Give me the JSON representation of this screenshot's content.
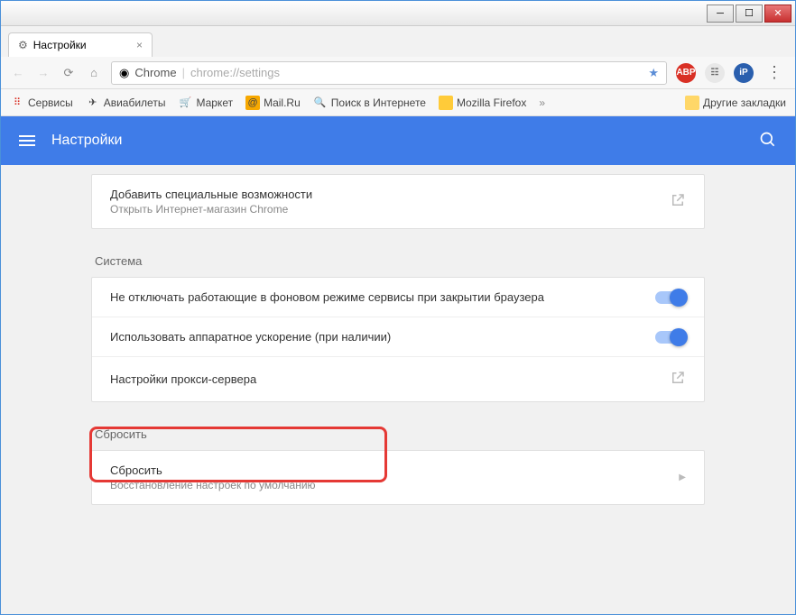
{
  "tab": {
    "title": "Настройки"
  },
  "omnibox": {
    "label": "Chrome",
    "url": "chrome://settings"
  },
  "bookmarks": {
    "items": [
      {
        "label": "Сервисы",
        "icon": "apps"
      },
      {
        "label": "Авиабилеты",
        "icon": "plane"
      },
      {
        "label": "Маркет",
        "icon": "cart"
      },
      {
        "label": "Mail.Ru",
        "icon": "mail"
      },
      {
        "label": "Поиск в Интернете",
        "icon": "search"
      },
      {
        "label": "Mozilla Firefox",
        "icon": "fx"
      }
    ],
    "other": "Другие закладки"
  },
  "header": {
    "title": "Настройки"
  },
  "accessibility": {
    "title": "Добавить специальные возможности",
    "subtitle": "Открыть Интернет-магазин Chrome"
  },
  "sections": {
    "system": "Система",
    "reset": "Сбросить"
  },
  "system": {
    "background": "Не отключать работающие в фоновом режиме сервисы при закрытии браузера",
    "hwaccel": "Использовать аппаратное ускорение (при наличии)",
    "proxy": "Настройки прокси-сервера"
  },
  "reset": {
    "title": "Сбросить",
    "subtitle": "Восстановление настроек по умолчанию"
  }
}
